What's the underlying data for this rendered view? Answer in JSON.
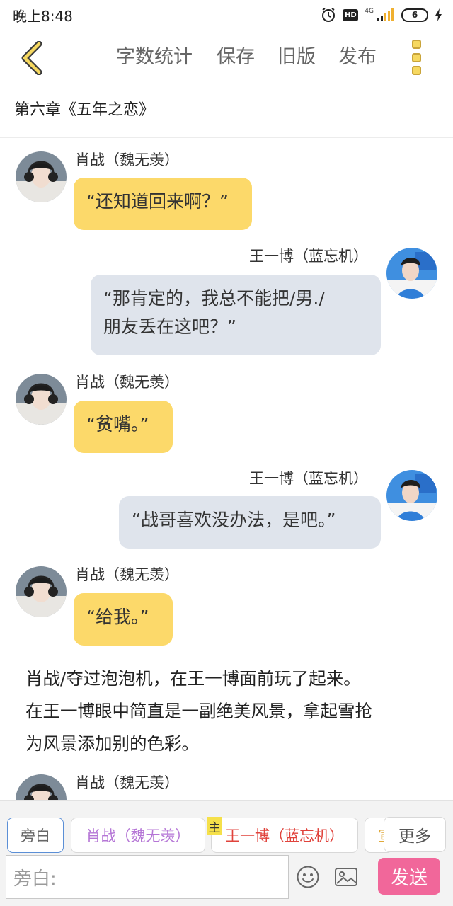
{
  "status_bar": {
    "time": "晚上8:48",
    "hd": "HD",
    "network": "4G",
    "battery": "6"
  },
  "toolbar": {
    "back_icon": "chevron-left-icon",
    "word_count": "字数统计",
    "save": "保存",
    "old_version": "旧版",
    "publish": "发布",
    "more_icon": "three-dots-vertical-icon"
  },
  "chapter": {
    "title": "第六章《五年之恋》"
  },
  "messages": [
    {
      "side": "left",
      "name": "肖战（魏无羡）",
      "lines": [
        "“还知道回来啊？”"
      ]
    },
    {
      "side": "right",
      "name": "王一博（蓝忘机）",
      "lines": [
        "“那肯定的，我总不能把/男./",
        "朋友丢在这吧？”"
      ]
    },
    {
      "side": "left",
      "name": "肖战（魏无羡）",
      "lines": [
        "“贫嘴。”"
      ]
    },
    {
      "side": "right",
      "name": "王一博（蓝忘机）",
      "lines": [
        "“战哥喜欢没办法，是吧。”"
      ]
    },
    {
      "side": "left",
      "name": "肖战（魏无羡）",
      "lines": [
        "“给我。”"
      ]
    },
    {
      "side": "left",
      "name": "肖战（魏无羡）",
      "lines": []
    }
  ],
  "narration": {
    "lines": [
      "肖战/夺过泡泡机，在王一博面前玩了起来。",
      "在王一博眼中简直是一副绝美风景，拿起雪抢",
      "为风景添加别的色彩。"
    ]
  },
  "bottom": {
    "roles": [
      "旁白",
      "肖战（魏无羡）",
      "王一博（蓝忘机）",
      "宣"
    ],
    "main_tag": "主",
    "more": "更多",
    "input_placeholder": "旁白:",
    "emoji_icon": "smile-icon",
    "image_icon": "image-icon",
    "send": "发送"
  },
  "colors": {
    "bubble_left": "#fcd96a",
    "bubble_right": "#dfe4ec",
    "send_button": "#f1679a",
    "role_xiao": "#b576d6",
    "role_wang": "#e0433c",
    "accent_yellow": "#f6d860"
  }
}
